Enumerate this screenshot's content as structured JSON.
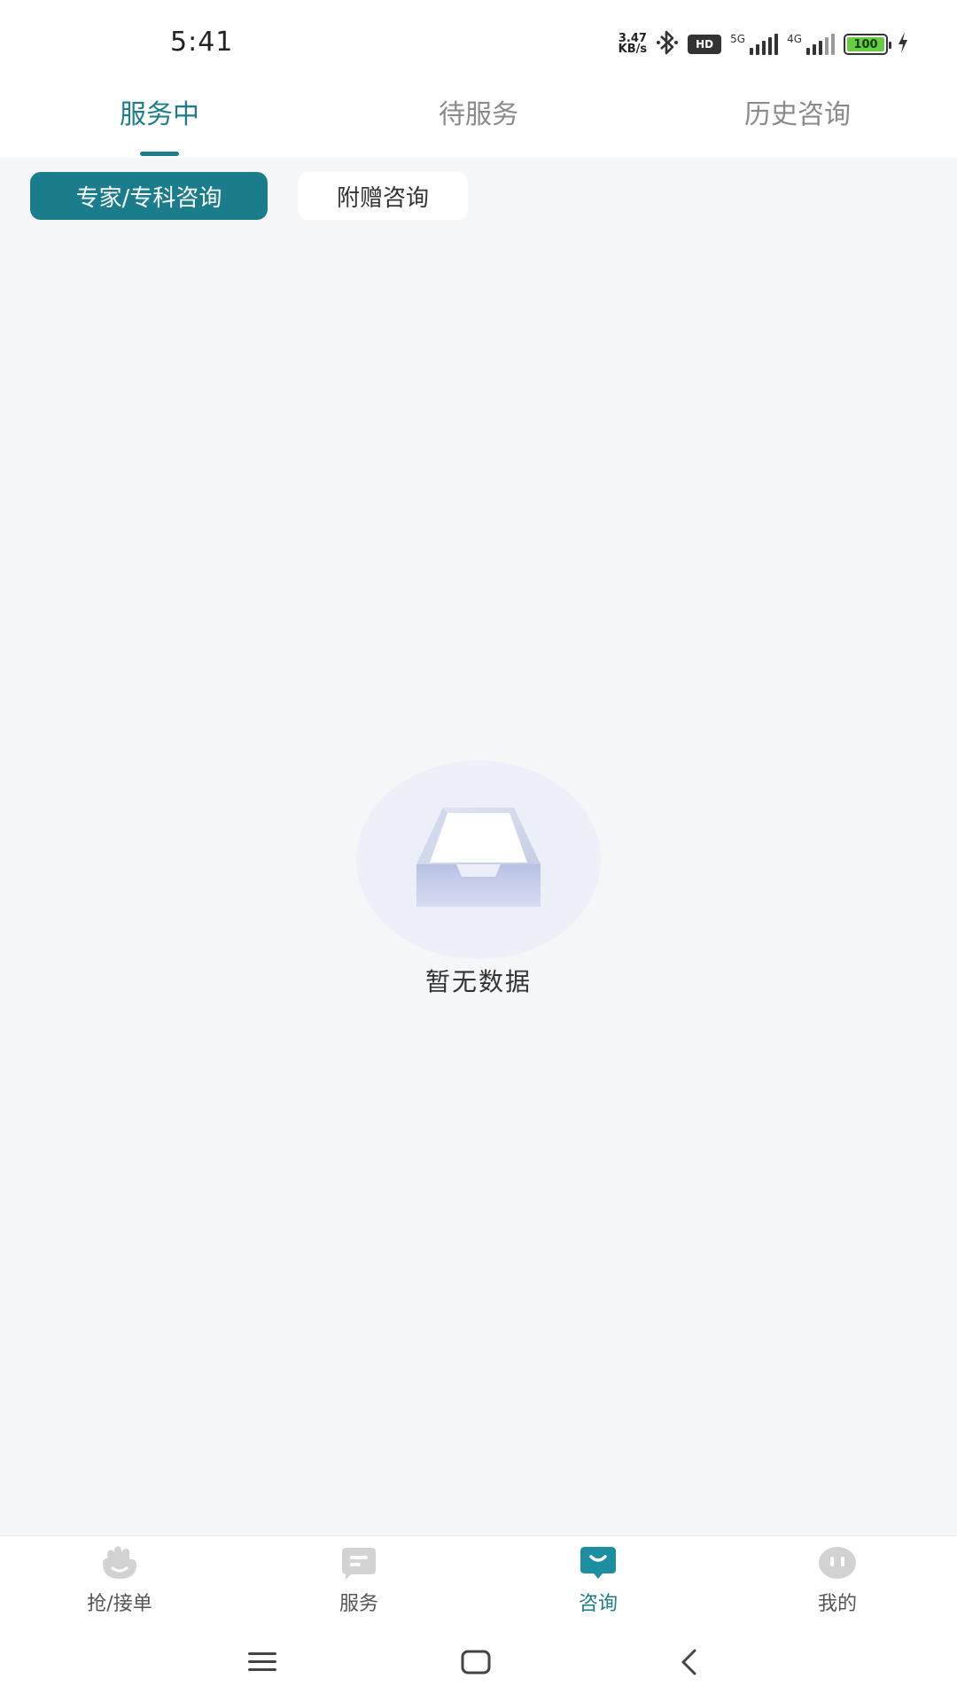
{
  "status_bar": {
    "time": "5:41",
    "net_speed_value": "3.47",
    "net_speed_unit": "KB/s",
    "hd_label": "HD",
    "sig1_label": "5G",
    "sig2_label": "4G",
    "battery_level": "100"
  },
  "top_tabs": [
    {
      "label": "服务中",
      "active": true
    },
    {
      "label": "待服务",
      "active": false
    },
    {
      "label": "历史咨询",
      "active": false
    }
  ],
  "segments": [
    {
      "label": "专家/专科咨询",
      "active": true
    },
    {
      "label": "附赠咨询",
      "active": false
    }
  ],
  "empty_state": {
    "text": "暂无数据",
    "icon": "empty-box-icon"
  },
  "bottom_nav": [
    {
      "label": "抢/接单",
      "icon": "hand-icon",
      "active": false
    },
    {
      "label": "服务",
      "icon": "service-icon",
      "active": false
    },
    {
      "label": "咨询",
      "icon": "consult-icon",
      "active": true
    },
    {
      "label": "我的",
      "icon": "profile-icon",
      "active": false
    }
  ],
  "colors": {
    "accent": "#1b7d8c",
    "background": "#f4f6f8",
    "inactive_tab": "#8a8a8a",
    "battery_green": "#66cc44"
  }
}
